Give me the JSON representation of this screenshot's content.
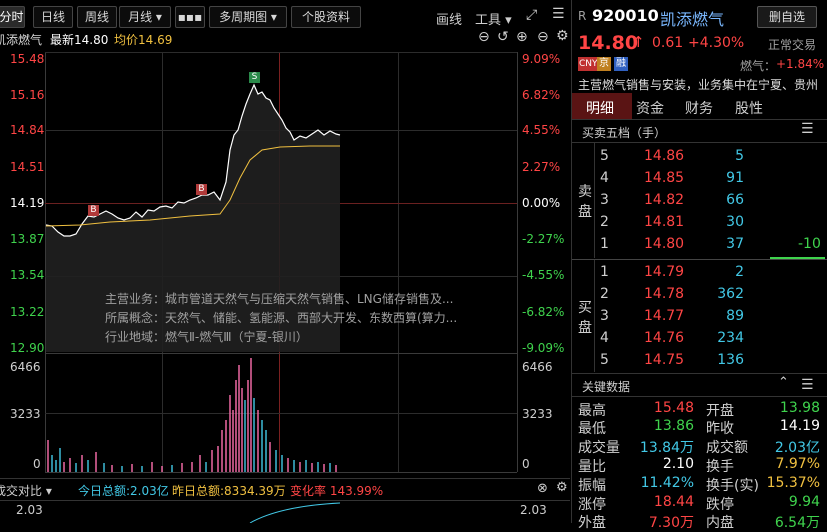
{
  "toolbar": {
    "tabs": [
      "分时",
      "日线",
      "周线",
      "月线 ▾",
      "▪▪▪",
      "多周期图 ▾",
      "个股资料"
    ],
    "draw_label": "画线",
    "tools_label": "工具 ▾"
  },
  "chart_header": {
    "name": "凯添燃气",
    "latest_label": "最新14.80",
    "avg_label": "均价14.69"
  },
  "price_axis": {
    "left": [
      "15.48",
      "15.16",
      "14.84",
      "14.51",
      "14.19",
      "13.87",
      "13.54",
      "13.22",
      "12.90"
    ],
    "right": [
      "9.09%",
      "6.82%",
      "4.55%",
      "2.27%",
      "0.00%",
      "-2.27%",
      "-4.55%",
      "-6.82%",
      "-9.09%"
    ]
  },
  "volume_axis": {
    "left": [
      "6466",
      "3233",
      "0"
    ],
    "right": [
      "6466",
      "3233",
      "0"
    ]
  },
  "markers": [
    "B",
    "B",
    "S"
  ],
  "info_overlay": {
    "business": "主营业务：城市管道天然气与压缩天然气销售、LNG储存销售及...",
    "concepts": "所属概念：天然气、储能、氢能源、西部大开发、东数西算(算力...",
    "region": "行业地域：燃气Ⅱ-燃气Ⅲ（宁夏-银川）"
  },
  "bottom_panel": {
    "title": "成交对比 ▾",
    "today_label": "今日总额:2.03亿",
    "yesterday_label": "昨日总额:8334.39万",
    "change_label": "变化率 143.99%",
    "axis_value": "2.03"
  },
  "stock": {
    "market_prefix": "R",
    "code": "920010",
    "name": "凯添燃气",
    "watch_button": "删自选",
    "price": "14.80",
    "arrow": "↑",
    "change": "0.61",
    "change_pct": "+4.30%",
    "status": "正常交易",
    "tags": [
      "CNY",
      "京",
      "融"
    ],
    "sector_label": "燃气：",
    "sector_change": "+1.84%",
    "description": "主营燃气销售与安装，业务集中在宁夏、贵州"
  },
  "detail_tabs": [
    "明细",
    "资金",
    "财务",
    "股性"
  ],
  "order_book": {
    "title": "买卖五档（手）",
    "sell_label": "卖盘",
    "buy_label": "买盘",
    "asks": [
      {
        "level": "5",
        "price": "14.86",
        "volume": "5",
        "change": ""
      },
      {
        "level": "4",
        "price": "14.85",
        "volume": "91",
        "change": ""
      },
      {
        "level": "3",
        "price": "14.82",
        "volume": "66",
        "change": ""
      },
      {
        "level": "2",
        "price": "14.81",
        "volume": "30",
        "change": ""
      },
      {
        "level": "1",
        "price": "14.80",
        "volume": "37",
        "change": "-10"
      }
    ],
    "bids": [
      {
        "level": "1",
        "price": "14.79",
        "volume": "2"
      },
      {
        "level": "2",
        "price": "14.78",
        "volume": "362"
      },
      {
        "level": "3",
        "price": "14.77",
        "volume": "89"
      },
      {
        "level": "4",
        "price": "14.76",
        "volume": "234"
      },
      {
        "level": "5",
        "price": "14.75",
        "volume": "136"
      }
    ]
  },
  "key_data": {
    "title": "关键数据",
    "rows": [
      {
        "l1": "最高",
        "v1": "15.48",
        "l2": "开盘",
        "v2": "13.98"
      },
      {
        "l1": "最低",
        "v1": "13.86",
        "l2": "昨收",
        "v2": "14.19"
      },
      {
        "l1": "成交量",
        "v1": "13.84万",
        "l2": "成交额",
        "v2": "2.03亿"
      },
      {
        "l1": "量比",
        "v1": "2.10",
        "l2": "换手",
        "v2": "7.97%"
      },
      {
        "l1": "振幅",
        "v1": "11.42%",
        "l2": "换手(实)",
        "v2": "15.37%"
      },
      {
        "l1": "涨停",
        "v1": "18.44",
        "l2": "跌停",
        "v2": "9.94"
      },
      {
        "l1": "外盘",
        "v1": "7.30万",
        "l2": "内盘",
        "v2": "6.54万"
      }
    ]
  },
  "colors": {
    "up": "#ff4545",
    "down": "#3fd34d",
    "price_line": "#ffffff",
    "avg_line": "#f0c040",
    "accent": "#ff4545"
  }
}
